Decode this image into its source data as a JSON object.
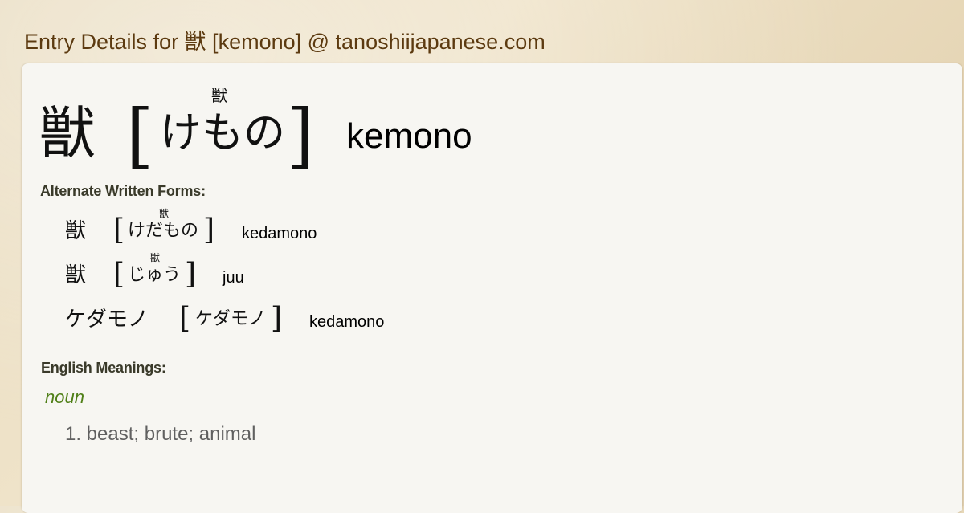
{
  "page_title": "Entry Details for 獣 [kemono] @ tanoshiijapanese.com",
  "entry": {
    "kanji": "獣",
    "ruby": "獣",
    "kana": "けもの",
    "romaji": "kemono",
    "bracket_open": "[",
    "bracket_close": "]"
  },
  "alternate_forms": {
    "label": "Alternate Written Forms:",
    "items": [
      {
        "written": "獣",
        "ruby": "獣",
        "kana": "けだもの",
        "romaji": "kedamono"
      },
      {
        "written": "獣",
        "ruby": "獣",
        "kana": "じゅう",
        "romaji": "juu"
      },
      {
        "written": "ケダモノ",
        "ruby": "",
        "kana": "ケダモノ",
        "romaji": "kedamono"
      }
    ]
  },
  "meanings": {
    "label": "English Meanings:",
    "part_of_speech": "noun",
    "items": [
      "1. beast; brute; animal"
    ]
  },
  "colors": {
    "title": "#5c3a10",
    "part_of_speech": "#4f7f17",
    "meaning_text": "#606060",
    "card_background": "#f7f6f2"
  }
}
